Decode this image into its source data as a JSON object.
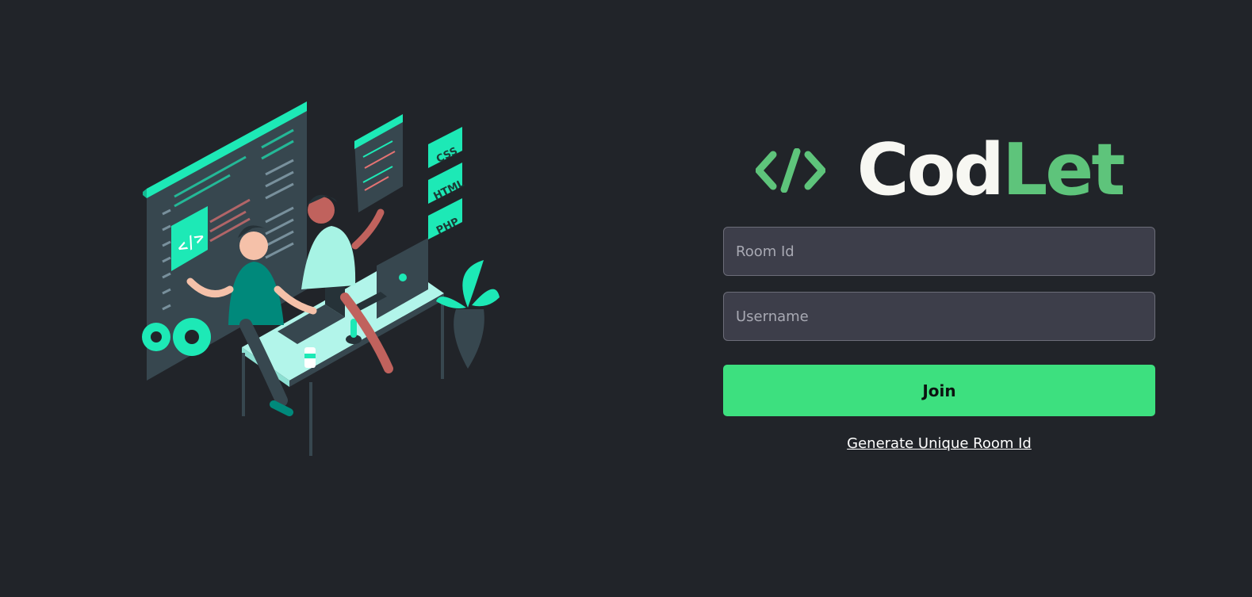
{
  "brand": {
    "name_part1": "Cod",
    "name_part2": "Let",
    "icon": "code-brackets-icon",
    "colors": {
      "primary_text": "#f7f7f2",
      "accent": "#5ec47b"
    }
  },
  "illustration": {
    "icon": "developers-illustration",
    "badges": [
      "CSS",
      "HTML",
      "PHP"
    ]
  },
  "form": {
    "room_id_placeholder": "Room Id",
    "room_id_value": "",
    "username_placeholder": "Username",
    "username_value": "",
    "join_label": "Join",
    "generate_link_label": "Generate Unique Room Id"
  },
  "theme": {
    "background": "#212429",
    "input_background": "#3d3e4a",
    "button": "#3de07f"
  }
}
